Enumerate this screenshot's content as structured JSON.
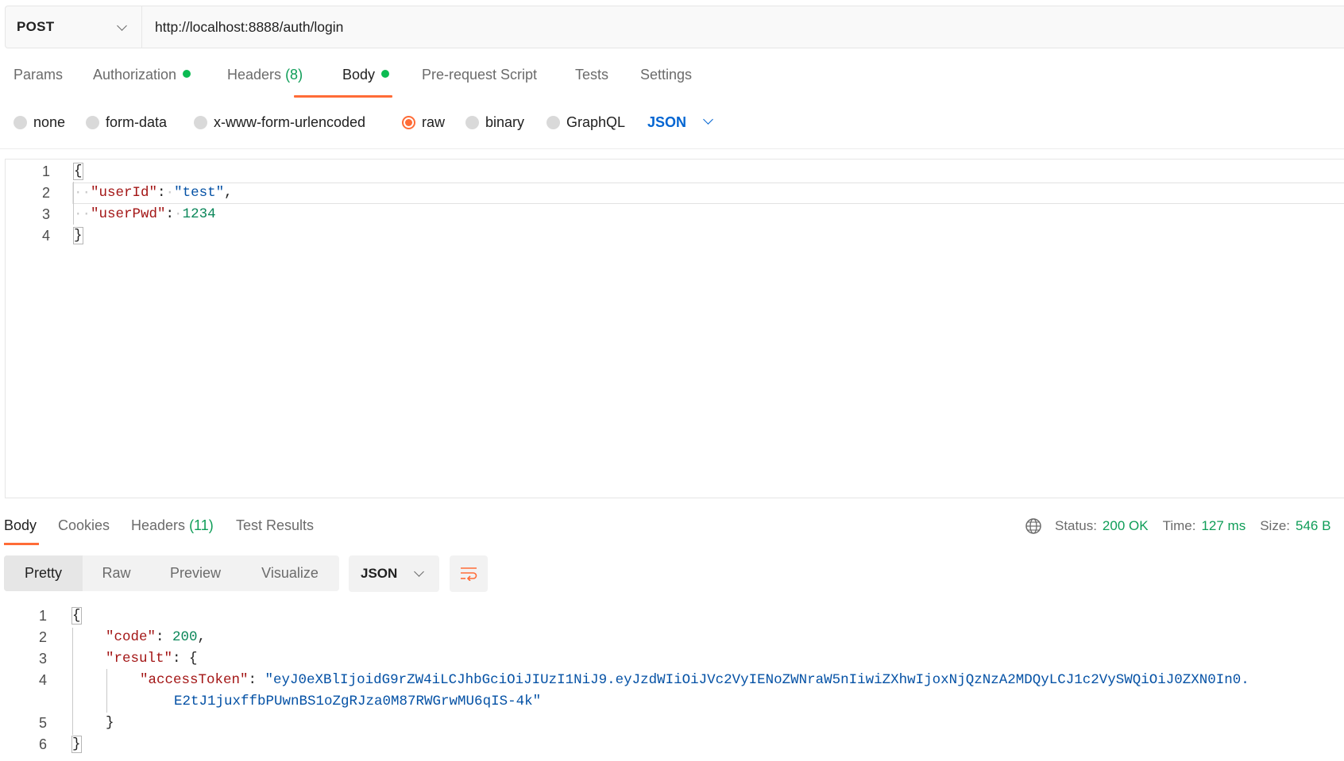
{
  "request": {
    "method": "POST",
    "url": "http://localhost:8888/auth/login"
  },
  "request_tabs": {
    "params": "Params",
    "authorization": "Authorization",
    "headers": "Headers",
    "headers_count": "(8)",
    "body": "Body",
    "pre_request": "Pre-request Script",
    "tests": "Tests",
    "settings": "Settings",
    "active": "Body",
    "status_dot_color": "#0cbb52"
  },
  "body_types": {
    "none": "none",
    "form_data": "form-data",
    "urlencoded": "x-www-form-urlencoded",
    "raw": "raw",
    "binary": "binary",
    "graphql": "GraphQL",
    "selected": "raw",
    "format": "JSON"
  },
  "request_body": {
    "line_numbers": [
      "1",
      "2",
      "3",
      "4"
    ],
    "open_brace": "{",
    "close_brace": "}",
    "key1": "\"userId\"",
    "val1": "\"test\"",
    "key2": "\"userPwd\"",
    "val2": "1234",
    "colon": ":",
    "comma": ","
  },
  "response_tabs": {
    "body": "Body",
    "cookies": "Cookies",
    "headers": "Headers",
    "headers_count": "(11)",
    "test_results": "Test Results"
  },
  "response_status": {
    "status_label": "Status:",
    "status_value": "200 OK",
    "time_label": "Time:",
    "time_value": "127 ms",
    "size_label": "Size:",
    "size_value": "546 B",
    "icon": "globe-icon"
  },
  "view_modes": {
    "pretty": "Pretty",
    "raw": "Raw",
    "preview": "Preview",
    "visualize": "Visualize",
    "active": "Pretty",
    "format": "JSON"
  },
  "response_body": {
    "line_numbers": [
      "1",
      "2",
      "3",
      "4",
      "",
      "5",
      "6"
    ],
    "open_brace": "{",
    "close_brace": "}",
    "code_key": "\"code\"",
    "code_val": "200",
    "result_key": "\"result\"",
    "token_key": "\"accessToken\"",
    "token_val_line1": "\"eyJ0eXBlIjoidG9rZW4iLCJhbGciOiJIUzI1NiJ9.eyJzdWIiOiJVc2VyIENoZWNraW5nIiwiZXhwIjoxNjQzNzA2MDQyLCJ1c2VySWQiOiJ0ZXN0In0.",
    "token_val_line2": "E2tJ1juxffbPUwnBS1oZgRJza0M87RWGrwMU6qIS-4k\"",
    "inner_close": "}"
  },
  "colors": {
    "accent": "#ff6c37",
    "success": "#0f9d58",
    "json_key": "#a31515",
    "json_string": "#0451a5",
    "json_number": "#098658",
    "link_blue": "#0265d2"
  }
}
